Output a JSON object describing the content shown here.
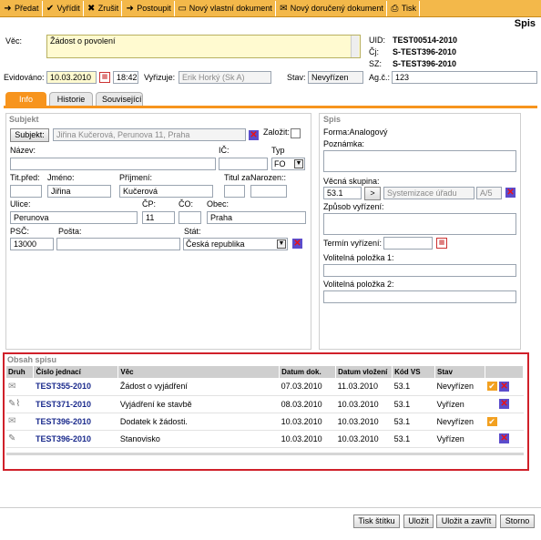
{
  "toolbar": {
    "items": [
      {
        "icon": "send-icon",
        "glyph": "➜",
        "label": "Předat"
      },
      {
        "icon": "check-icon",
        "glyph": "✔",
        "label": "Vyřídit"
      },
      {
        "icon": "cancel-icon",
        "glyph": "✖",
        "label": "Zrušit"
      },
      {
        "icon": "forward-icon",
        "glyph": "➜",
        "label": "Postoupit"
      },
      {
        "icon": "document-icon",
        "glyph": "▭",
        "label": "Nový vlastní dokument"
      },
      {
        "icon": "envelope-icon",
        "glyph": "✉",
        "label": "Nový doručený dokument"
      },
      {
        "icon": "printer-icon",
        "glyph": "⎙",
        "label": "Tisk"
      }
    ]
  },
  "page_title": "Spis",
  "header": {
    "vec_label": "Věc:",
    "vec_value": "Žádost o povolení",
    "uid_label": "UID:",
    "uid_value": "TEST00514-2010",
    "cj_label": "Čj:",
    "cj_value": "S-TEST396-2010",
    "sz_label": "SZ:",
    "sz_value": "S-TEST396-2010",
    "evidovano_label": "Evidováno:",
    "evidovano_date": "10.03.2010",
    "evidovano_time": "18:42",
    "vyrizuje_label": "Vyřizuje:",
    "vyrizuje_value": "Erik Horký (Sk A)",
    "stav_label": "Stav:",
    "stav_value": "Nevyřízen",
    "agc_label": "Ag.č.:",
    "agc_value": "123"
  },
  "tabs": [
    "Info",
    "Historie",
    "Související"
  ],
  "subjekt": {
    "title": "Subjekt",
    "subjekt_button": "Subjekt:",
    "subjekt_value": "Jiřina Kučerová, Perunova 11, Praha",
    "zalozit_label": "Založit:",
    "nazev_label": "Název:",
    "ic_label": "IČ:",
    "typ_label": "Typ",
    "typ_value": "FO",
    "titpred_label": "Tit.před:",
    "jmeno_label": "Jméno:",
    "jmeno_value": "Jiřina",
    "prijmeni_label": "Příjmení:",
    "prijmeni_value": "Kučerová",
    "titulza_label": "Titul za:",
    "narozen_label": "Narozen::",
    "ulice_label": "Ulice:",
    "ulice_value": "Perunova",
    "cp_label": "ČP:",
    "cp_value": "11",
    "co_label": "ČO:",
    "obec_label": "Obec:",
    "obec_value": "Praha",
    "psc_label": "PSČ:",
    "psc_value": "13000",
    "posta_label": "Pošta:",
    "stat_label": "Stát:",
    "stat_value": "Česká republika"
  },
  "spis": {
    "title": "Spis",
    "forma": "Forma:Analogový",
    "poznamka_label": "Poznámka:",
    "vecna_label": "Věcná skupina:",
    "vecna_code": "53.1",
    "vecna_arrow": ">",
    "vecna_name": "Systemizace úřadu",
    "vecna_sk": "A/5",
    "zpusob_label": "Způsob vyřízení:",
    "termin_label": "Termín vyřízení:",
    "vol1_label": "Volitelná položka 1:",
    "vol2_label": "Volitelná položka 2:"
  },
  "obsah": {
    "title": "Obsah spisu",
    "columns": [
      "Druh",
      "Číslo jednací",
      "Věc",
      "Datum dok.",
      "Datum vložení",
      "Kód VS",
      "Stav"
    ],
    "rows": [
      {
        "druh": "envelope-icon",
        "cj": "TEST355-2010",
        "vec": "Žádost o vyjádření",
        "datum_dok": "07.03.2010",
        "datum_vlozeni": "11.03.2010",
        "kod": "53.1",
        "stav": "Nevyřízen",
        "check": true
      },
      {
        "druh": "pencil-clip-icon",
        "cj": "TEST371-2010",
        "vec": "Vyjádření ke stavbě",
        "datum_dok": "08.03.2010",
        "datum_vlozeni": "10.03.2010",
        "kod": "53.1",
        "stav": "Vyřízen",
        "check": false
      },
      {
        "druh": "envelope-icon",
        "cj": "TEST396-2010",
        "vec": "Dodatek k žádosti.",
        "datum_dok": "10.03.2010",
        "datum_vlozeni": "10.03.2010",
        "kod": "53.1",
        "stav": "Nevyřízen",
        "check": true
      },
      {
        "druh": "pencil-icon",
        "cj": "TEST396-2010",
        "vec": "Stanovisko",
        "datum_dok": "10.03.2010",
        "datum_vlozeni": "10.03.2010",
        "kod": "53.1",
        "stav": "Vyřízen",
        "check": false
      }
    ]
  },
  "footer": {
    "buttons": [
      "Tisk štítku",
      "Uložit",
      "Uložit a zavřít",
      "Storno"
    ]
  },
  "colors": {
    "accent": "#f7941d",
    "highlight_border": "#d0202a",
    "link": "#1a2a8c"
  }
}
